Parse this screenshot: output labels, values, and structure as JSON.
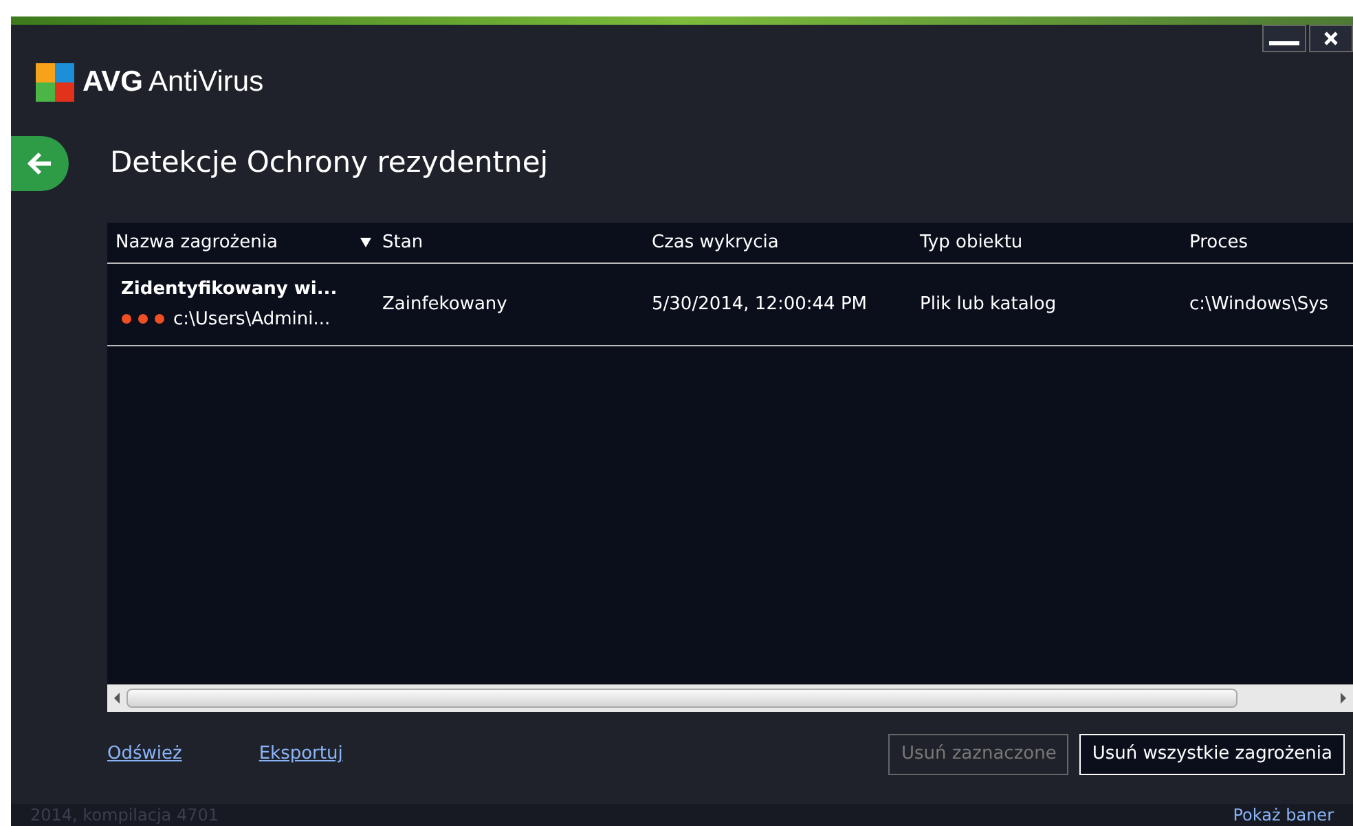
{
  "app": {
    "brand": "AVG",
    "product": "AntiVirus"
  },
  "page": {
    "title": "Detekcje Ochrony rezydentnej"
  },
  "table": {
    "columns": [
      {
        "label": "Nazwa zagrożenia",
        "sorted": true
      },
      {
        "label": "Stan",
        "sorted": false
      },
      {
        "label": "Czas wykrycia",
        "sorted": false
      },
      {
        "label": "Typ obiektu",
        "sorted": false
      },
      {
        "label": "Proces",
        "sorted": false
      }
    ],
    "rows": [
      {
        "name": "Zidentyfikowany wi...",
        "path": "c:\\Users\\Admini...",
        "status": "Zainfekowany",
        "time": "5/30/2014, 12:00:44 PM",
        "type": "Plik lub katalog",
        "process": "c:\\Windows\\Sys"
      }
    ]
  },
  "links": [
    "Odśwież",
    "Eksportuj"
  ],
  "buttons": [
    {
      "label": "Usuń zaznaczone",
      "disabled": true
    },
    {
      "label": "Usuń wszystkie zagrożenia",
      "disabled": false
    }
  ],
  "footer": {
    "build": "2014, kompilacja 4701",
    "banner_link": "Pokaż baner"
  }
}
